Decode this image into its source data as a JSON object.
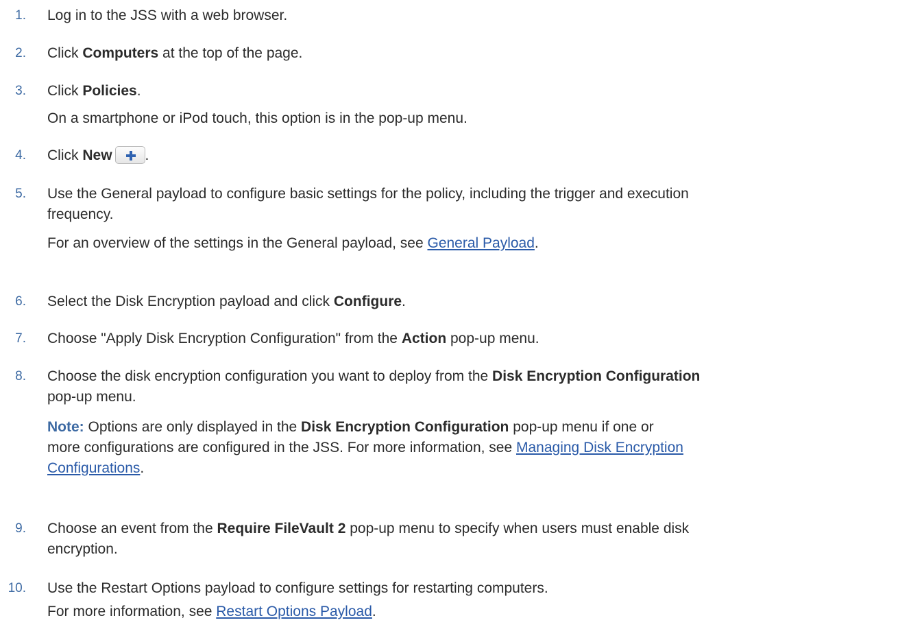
{
  "steps": [
    {
      "number": "1.",
      "text": "Log in to the JSS with a web browser."
    },
    {
      "number": "2.",
      "pre": "Click ",
      "bold": "Computers",
      "post": " at the top of the page."
    },
    {
      "number": "3.",
      "pre": "Click ",
      "bold": "Policies",
      "post": ".",
      "sub": "On a smartphone or iPod touch, this option is in the pop-up menu."
    },
    {
      "number": "4.",
      "pre": "Click ",
      "bold": "New",
      "post": "."
    },
    {
      "number": "5.",
      "line1": "Use the General payload to configure basic settings for the policy, including the trigger and execution",
      "line2": "frequency.",
      "sub_pre": "For an overview of the settings in the General payload, see ",
      "sub_link": "General Payload",
      "sub_post": "."
    },
    {
      "number": "6.",
      "pre": "Select the Disk Encryption payload and click ",
      "bold": "Configure",
      "post": "."
    },
    {
      "number": "7.",
      "pre": "Choose \"Apply Disk Encryption Configuration\" from the ",
      "bold": "Action",
      "post": " pop-up menu."
    },
    {
      "number": "8.",
      "pre": "Choose the disk encryption configuration you want to deploy from the ",
      "bold": "Disk Encryption Configuration",
      "line2": "pop-up menu.",
      "note_label": "Note:",
      "note_pre": " Options are only displayed in the ",
      "note_bold": "Disk Encryption Configuration",
      "note_post": " pop-up menu if one or",
      "note_line2": "more configurations are configured in the JSS. For more information, see ",
      "note_link1": "Managing Disk Encryption ",
      "note_link2": "Configurations",
      "note_end": "."
    },
    {
      "number": "9.",
      "pre": "Choose an event from the ",
      "bold": "Require FileVault 2",
      "post": " pop-up menu to specify when users must enable disk",
      "line2": "encryption."
    },
    {
      "number": "10.",
      "text": "Use the Restart Options payload to configure settings for restarting computers.",
      "sub_pre": "For more information, see ",
      "sub_link": "Restart Options Payload",
      "sub_post": "."
    }
  ],
  "icons": {
    "new_button": "plus-icon"
  },
  "colors": {
    "number": "#3d6aa3",
    "link": "#2a5aa8",
    "note": "#3d6aa3"
  }
}
